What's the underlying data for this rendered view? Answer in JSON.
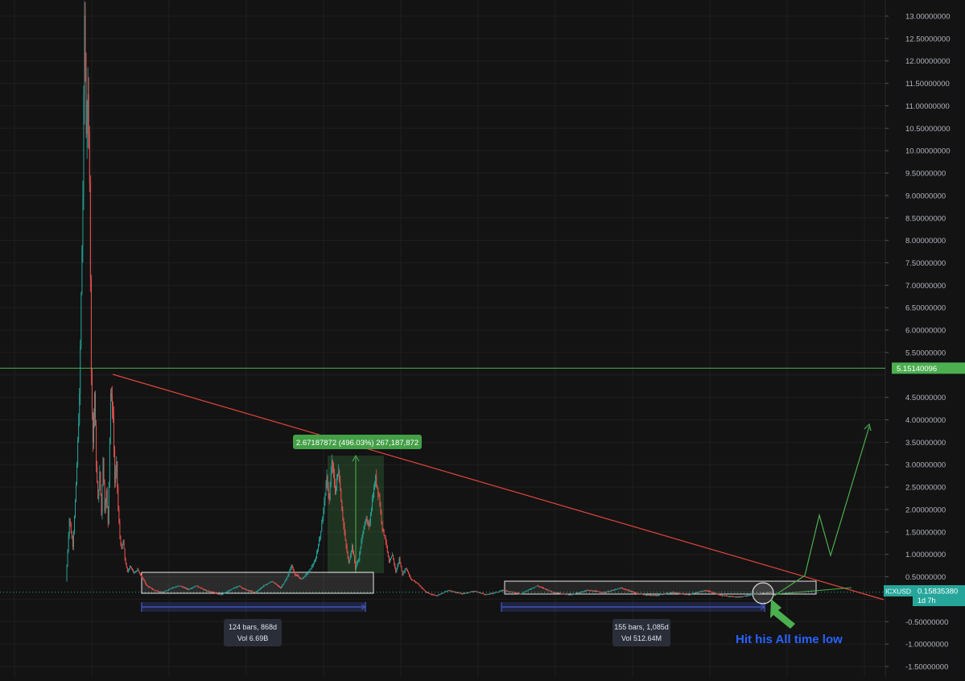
{
  "chart_data": {
    "type": "candlestick",
    "symbol": "ICXUSD",
    "colors": {
      "background": "#131313",
      "grid": "#1f1f1f",
      "axis_text": "#b2b5be",
      "up": "#26a69a",
      "down": "#ef5350",
      "trendline": "#e0453f",
      "level_line": "#4caf50",
      "last_price_badge": "#26a69a",
      "level_badge": "#4caf50",
      "range_box": "#e6e6e6",
      "range_ruler": "#3f51b5",
      "info_box": "#2a2e39",
      "annotation_text": "#2962ff",
      "arrow": "#4caf50"
    },
    "y_axis": {
      "min": -1.6,
      "max": 13.2,
      "tick_labels": [
        "13.00000000",
        "12.50000000",
        "12.00000000",
        "11.50000000",
        "11.00000000",
        "10.50000000",
        "10.00000000",
        "9.50000000",
        "9.00000000",
        "8.50000000",
        "8.00000000",
        "7.50000000",
        "7.00000000",
        "6.50000000",
        "6.00000000",
        "5.50000000",
        "4.50000000",
        "4.00000000",
        "3.50000000",
        "3.00000000",
        "2.50000000",
        "2.00000000",
        "1.50000000",
        "1.00000000",
        "0.50000000",
        "-0.50000000",
        "-1.00000000",
        "-1.50000000"
      ],
      "tick_values": [
        13,
        12.5,
        12,
        11.5,
        11,
        10.5,
        10,
        9.5,
        9,
        8.5,
        8,
        7.5,
        7,
        6.5,
        6,
        5.5,
        4.5,
        4,
        3.5,
        3,
        2.5,
        2,
        1.5,
        1,
        0.5,
        -0.5,
        -1,
        -1.5
      ]
    },
    "price_path": [
      [
        0,
        0.4
      ],
      [
        4,
        1.8
      ],
      [
        8,
        1.2
      ],
      [
        12,
        2.5
      ],
      [
        16,
        4.5
      ],
      [
        20,
        9.0
      ],
      [
        22,
        13.0
      ],
      [
        24,
        10.5
      ],
      [
        26,
        11.0
      ],
      [
        28,
        9.5
      ],
      [
        30,
        5.0
      ],
      [
        32,
        3.5
      ],
      [
        34,
        4.6
      ],
      [
        36,
        3.0
      ],
      [
        38,
        2.2
      ],
      [
        40,
        2.8
      ],
      [
        42,
        1.9
      ],
      [
        44,
        3.2
      ],
      [
        46,
        2.0
      ],
      [
        48,
        2.4
      ],
      [
        50,
        1.7
      ],
      [
        53,
        4.6
      ],
      [
        56,
        4.1
      ],
      [
        58,
        2.6
      ],
      [
        60,
        3.0
      ],
      [
        62,
        2.0
      ],
      [
        64,
        1.4
      ],
      [
        66,
        1.1
      ],
      [
        68,
        1.3
      ],
      [
        70,
        0.9
      ],
      [
        73,
        0.6
      ],
      [
        76,
        0.75
      ],
      [
        80,
        0.6
      ],
      [
        85,
        0.65
      ],
      [
        90,
        0.5
      ],
      [
        96,
        0.3
      ],
      [
        105,
        0.2
      ],
      [
        115,
        0.15
      ],
      [
        125,
        0.25
      ],
      [
        135,
        0.3
      ],
      [
        145,
        0.22
      ],
      [
        155,
        0.3
      ],
      [
        165,
        0.2
      ],
      [
        175,
        0.15
      ],
      [
        185,
        0.1
      ],
      [
        195,
        0.2
      ],
      [
        205,
        0.3
      ],
      [
        215,
        0.2
      ],
      [
        225,
        0.15
      ],
      [
        235,
        0.3
      ],
      [
        245,
        0.4
      ],
      [
        255,
        0.25
      ],
      [
        262,
        0.45
      ],
      [
        268,
        0.75
      ],
      [
        272,
        0.55
      ],
      [
        280,
        0.45
      ],
      [
        288,
        0.6
      ],
      [
        296,
        0.85
      ],
      [
        302,
        1.4
      ],
      [
        306,
        2.0
      ],
      [
        310,
        2.7
      ],
      [
        313,
        2.2
      ],
      [
        316,
        3.1
      ],
      [
        320,
        2.4
      ],
      [
        324,
        2.9
      ],
      [
        328,
        2.0
      ],
      [
        332,
        1.3
      ],
      [
        336,
        0.8
      ],
      [
        340,
        1.2
      ],
      [
        344,
        0.7
      ],
      [
        348,
        0.9
      ],
      [
        352,
        1.4
      ],
      [
        356,
        1.8
      ],
      [
        360,
        1.6
      ],
      [
        364,
        2.2
      ],
      [
        368,
        2.7
      ],
      [
        372,
        2.3
      ],
      [
        376,
        1.6
      ],
      [
        380,
        1.3
      ],
      [
        384,
        0.8
      ],
      [
        388,
        1.0
      ],
      [
        392,
        0.6
      ],
      [
        396,
        0.9
      ],
      [
        400,
        0.55
      ],
      [
        404,
        0.7
      ],
      [
        410,
        0.45
      ],
      [
        418,
        0.35
      ],
      [
        428,
        0.15
      ],
      [
        440,
        0.08
      ],
      [
        455,
        0.2
      ],
      [
        470,
        0.12
      ],
      [
        485,
        0.18
      ],
      [
        500,
        0.1
      ],
      [
        520,
        0.2
      ],
      [
        540,
        0.12
      ],
      [
        560,
        0.3
      ],
      [
        580,
        0.15
      ],
      [
        600,
        0.1
      ],
      [
        620,
        0.2
      ],
      [
        640,
        0.15
      ],
      [
        660,
        0.25
      ],
      [
        680,
        0.12
      ],
      [
        700,
        0.08
      ],
      [
        720,
        0.15
      ],
      [
        740,
        0.1
      ],
      [
        760,
        0.2
      ],
      [
        780,
        0.08
      ],
      [
        800,
        0.05
      ],
      [
        820,
        0.12
      ],
      [
        840,
        0.16
      ]
    ],
    "level_line": {
      "value": 5.1514,
      "label": "5.15140096"
    },
    "last_price": {
      "label": "0.15835380",
      "countdown": "1d 7h"
    },
    "measure_label": "2.67187872 (496.03%) 267,187,872",
    "ranges": [
      {
        "bars": "124 bars, 868d",
        "vol": "Vol 6.69B"
      },
      {
        "bars": "155 bars, 1,085d",
        "vol": "Vol 512.64M"
      }
    ],
    "annotation": "Hit his All time low"
  }
}
